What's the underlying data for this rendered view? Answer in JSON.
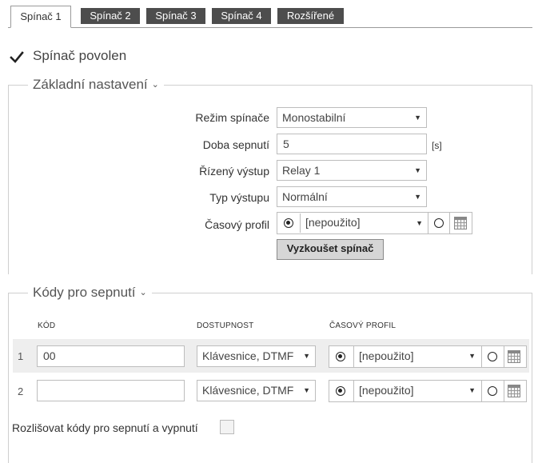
{
  "tabs": [
    {
      "label": "Spínač 1",
      "active": true
    },
    {
      "label": "Spínač 2",
      "active": false
    },
    {
      "label": "Spínač 3",
      "active": false
    },
    {
      "label": "Spínač 4",
      "active": false
    },
    {
      "label": "Rozšířené",
      "active": false
    }
  ],
  "switch_enabled": {
    "label": "Spínač povolen",
    "checked": true
  },
  "basic": {
    "legend": "Základní nastavení",
    "mode_label": "Režim spínače",
    "mode_value": "Monostabilní",
    "duration_label": "Doba sepnutí",
    "duration_value": "5",
    "duration_unit": "[s]",
    "output_label": "Řízený výstup",
    "output_value": "Relay 1",
    "output_type_label": "Typ výstupu",
    "output_type_value": "Normální",
    "time_profile_label": "Časový profil",
    "time_profile_value": "[nepoužito]",
    "test_button": "Vyzkoušet spínač"
  },
  "codes": {
    "legend": "Kódy pro sepnutí",
    "headers": {
      "code": "KÓD",
      "availability": "DOSTUPNOST",
      "profile": "ČASOVÝ PROFIL"
    },
    "rows": [
      {
        "num": "1",
        "code": "00",
        "availability": "Klávesnice, DTMF",
        "profile": "[nepoužito]"
      },
      {
        "num": "2",
        "code": "",
        "availability": "Klávesnice, DTMF",
        "profile": "[nepoužito]"
      }
    ],
    "distinguish_label": "Rozlišovat kódy pro sepnutí a vypnutí",
    "distinguish_checked": false
  },
  "icons": {
    "chevron": "chevron-down-icon",
    "dropdown": "dropdown-arrow-icon",
    "calendar": "calendar-icon",
    "check": "checkmark-icon"
  },
  "colors": {
    "tab_dark": "#4d4d4d",
    "button_bg": "#d6d6d6",
    "row_bg": "#eeeeee"
  }
}
